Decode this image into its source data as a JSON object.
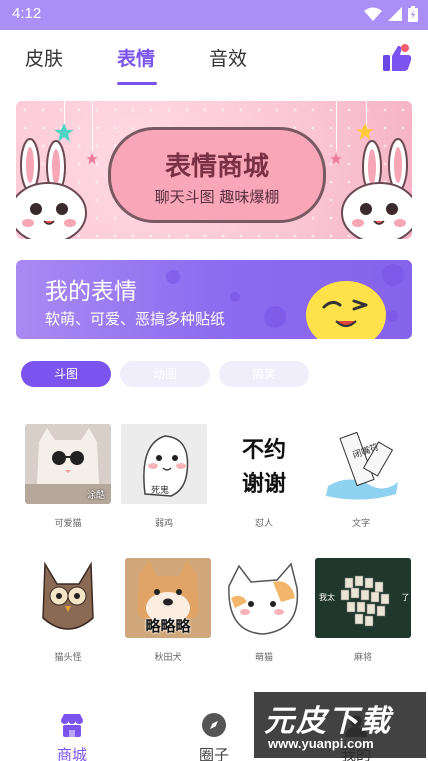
{
  "status_bar": {
    "time": "4:12"
  },
  "tabs": [
    {
      "label": "皮肤",
      "active": false
    },
    {
      "label": "表情",
      "active": true
    },
    {
      "label": "音效",
      "active": false
    }
  ],
  "banner": {
    "title": "表情商城",
    "subtitle": "聊天斗图 趣味爆棚"
  },
  "my_stickers": {
    "title": "我的表情",
    "subtitle": "软萌、可爱、恶搞多种贴纸"
  },
  "filters": [
    {
      "label": "斗图",
      "active": true
    },
    {
      "label": "动图",
      "active": false
    },
    {
      "label": "搞笑",
      "active": false
    }
  ],
  "stickers": [
    {
      "label": "可爱猫",
      "caption": "涂酷"
    },
    {
      "label": "弱鸡",
      "caption": "死鬼"
    },
    {
      "label": "怼人",
      "caption": "不约 谢谢"
    },
    {
      "label": "文字",
      "caption": "闭嘴符"
    },
    {
      "label": "猫头怪",
      "caption": ""
    },
    {
      "label": "秋田犬",
      "caption": "略略略"
    },
    {
      "label": "萌猫",
      "caption": ""
    },
    {
      "label": "麻将",
      "caption": "我太 了"
    }
  ],
  "bottom_nav": [
    {
      "label": "商城",
      "active": true,
      "icon": "shop-icon"
    },
    {
      "label": "圈子",
      "active": false,
      "icon": "compass-icon"
    },
    {
      "label": "我的",
      "active": false,
      "icon": "profile-icon"
    }
  ],
  "watermark": {
    "title": "元皮下载",
    "url": "www.yuanpi.com"
  },
  "colors": {
    "accent": "#7b54f0",
    "status_bar": "#a98ff7",
    "card_gradient_start": "#a98af3",
    "card_gradient_end": "#8563ec"
  }
}
